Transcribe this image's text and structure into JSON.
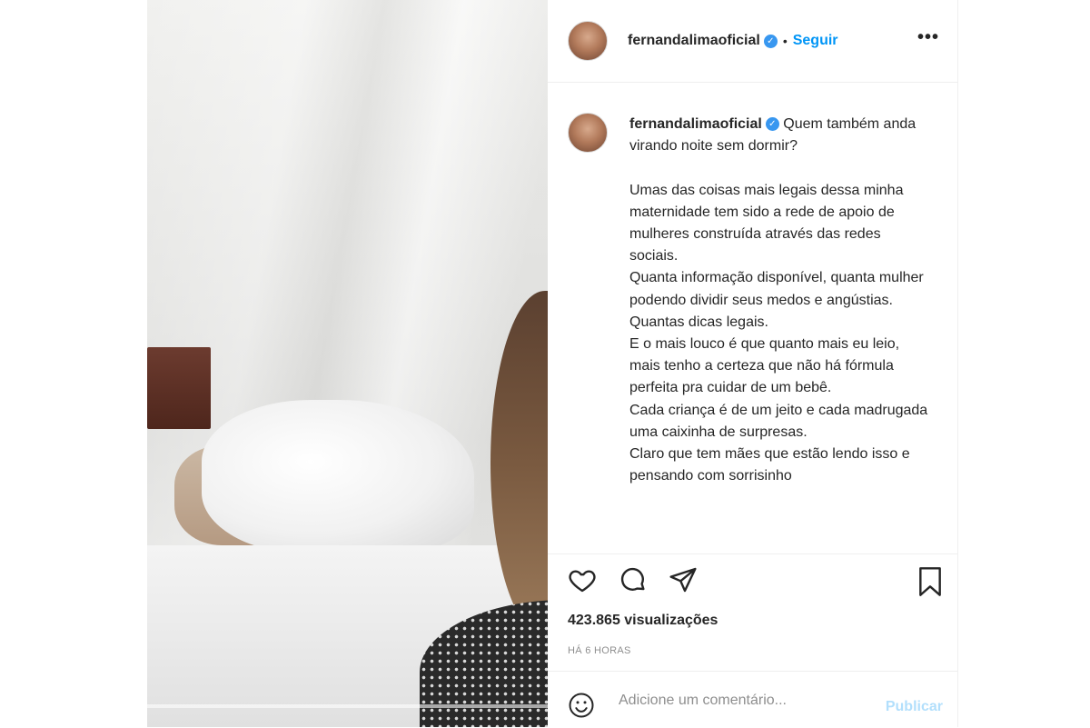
{
  "post": {
    "username": "fernandalimaoficial",
    "follow_label": "Seguir",
    "separator": "•",
    "more_label": "•••",
    "caption": "Quem também anda virando noite sem dormir?\n\nUmas das coisas mais legais dessa minha maternidade tem sido a rede de apoio de mulheres construída através das redes sociais.\nQuanta informação disponível, quanta mulher podendo dividir seus medos e angústias.\nQuantas dicas legais.\nE o mais louco é que quanto mais eu leio, mais tenho a certeza que não há fórmula perfeita pra cuidar de um bebê.\nCada criança é de um jeito e cada madrugada uma caixinha de surpresas.\nClaro que tem mães que estão lendo isso e pensando com sorrisinho",
    "views": "423.865 visualizações",
    "time": "HÁ 6 HORAS"
  },
  "video": {
    "progress": 0.0
  },
  "comment": {
    "placeholder": "Adicione um comentário...",
    "publish_label": "Publicar"
  },
  "icons": {
    "like": "heart-icon",
    "comment": "comment-icon",
    "share": "share-icon",
    "save": "bookmark-icon",
    "emoji": "emoji-icon",
    "verified": "verified-badge-icon"
  },
  "colors": {
    "link": "#0095f6",
    "publish_disabled": "#b2dffc",
    "verified": "#3897f0",
    "muted": "#8e8e8e"
  }
}
